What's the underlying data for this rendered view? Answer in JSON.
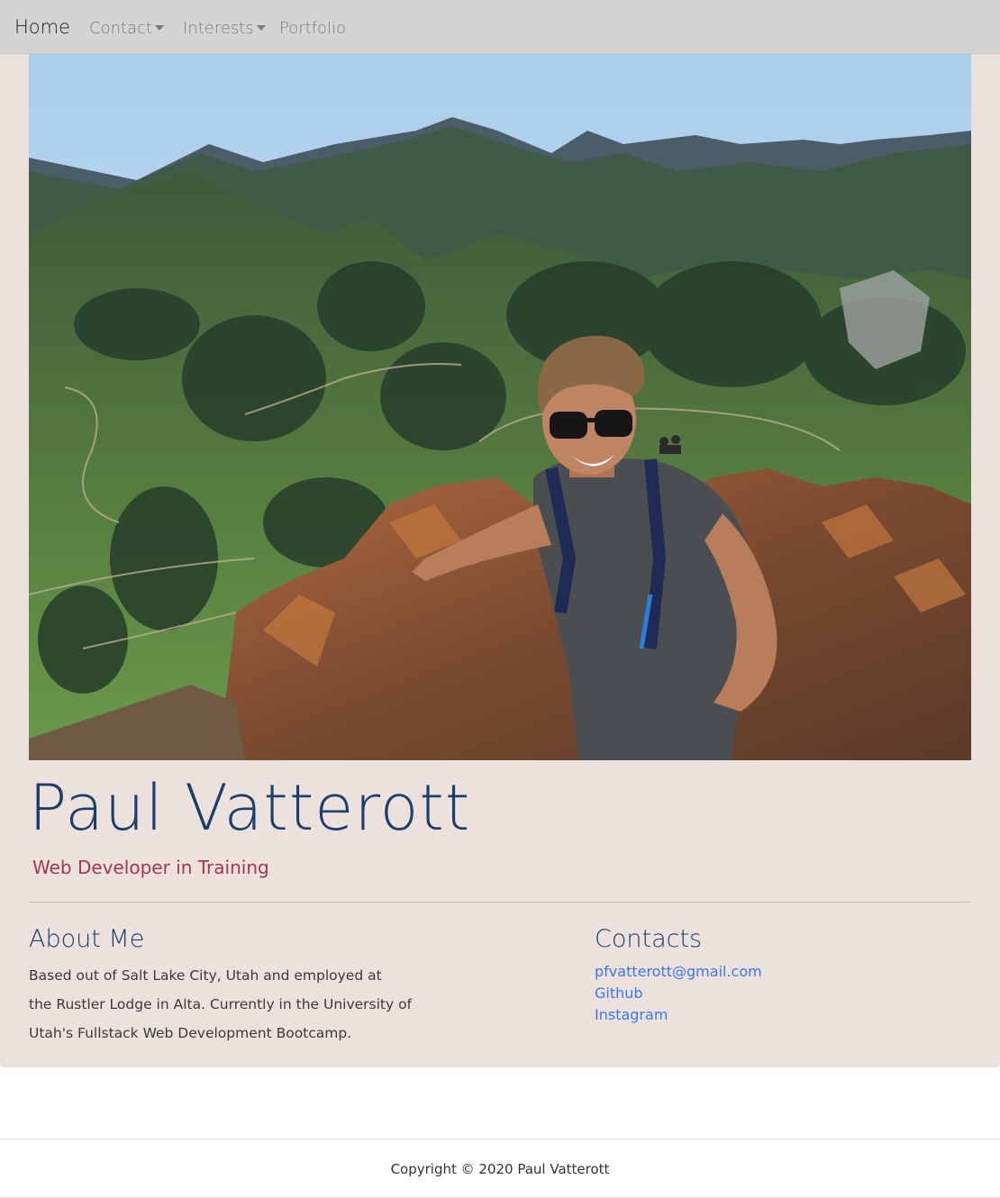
{
  "navbar": {
    "brand": "Home",
    "items": [
      {
        "label": "Contact",
        "dropdown": true
      },
      {
        "label": "Interests",
        "dropdown": true
      },
      {
        "label": "Portfolio",
        "dropdown": false
      }
    ]
  },
  "hero": {
    "profile_name": "Paul Vatterott",
    "tagline": "Web Developer in Training"
  },
  "about": {
    "title": "About Me",
    "lines": [
      "Based out of Salt Lake City, Utah and employed at",
      "the Rustler Lodge in Alta. Currently in the University of",
      "Utah's Fullstack Web Development Bootcamp."
    ]
  },
  "contacts": {
    "title": "Contacts",
    "links": [
      "pfvatterott@gmail.com",
      "Github",
      "Instagram"
    ]
  },
  "footer": {
    "copyright": "Copyright © 2020 Paul Vatterott"
  },
  "colors": {
    "navbar_bg": "#d4d4d4",
    "card_bg": "#ede1de",
    "name_color": "#1b3e6a",
    "tagline_color": "#a03a4c",
    "link_color": "#3b79e6"
  }
}
